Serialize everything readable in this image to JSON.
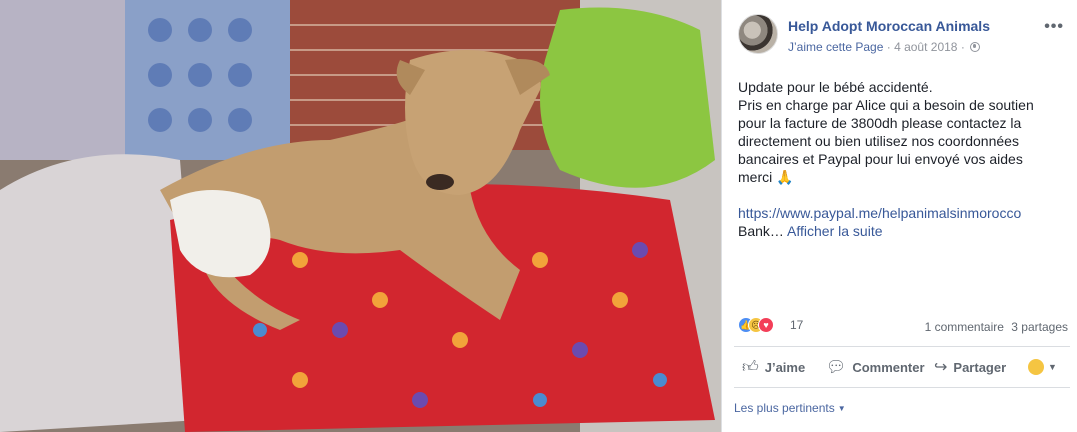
{
  "photo": {
    "description_icon": "dog-photo"
  },
  "post": {
    "page_name": "Help Adopt Moroccan Animals",
    "like_page": "J’aime cette Page",
    "separator": "·",
    "date": "4 août 2018",
    "separator2": "·",
    "audience_icon": "globe-icon",
    "more_label": "•••",
    "text_lines": [
      "Update pour le bébé accidenté.",
      "Pris en charge par Alice qui a besoin de soutien",
      "pour la facture de 3800dh please contactez la",
      "directement ou bien utilisez nos coordonnées",
      "bancaires et Paypal pour lui envoyé vos aides",
      "merci 🙏"
    ],
    "link": "https://www.paypal.me/helpanimalsinmorocco",
    "truncated_text": "Bank…",
    "see_more": "Afficher la suite"
  },
  "stats": {
    "reaction_icons": [
      "like-icon",
      "sad-icon",
      "love-icon"
    ],
    "reaction_count": "17",
    "comments": "1 commentaire",
    "shares": "3 partages"
  },
  "actions": {
    "like": "J’aime",
    "comment": "Commenter",
    "share": "Partager"
  },
  "comments_sort": {
    "label": "Les plus pertinents"
  },
  "colors": {
    "link": "#385898",
    "secondary_text": "#90949c",
    "action_text": "#606770",
    "like_blue": "#4d8ef4",
    "love_red": "#f33e58",
    "sad_yellow": "#f5c542"
  }
}
